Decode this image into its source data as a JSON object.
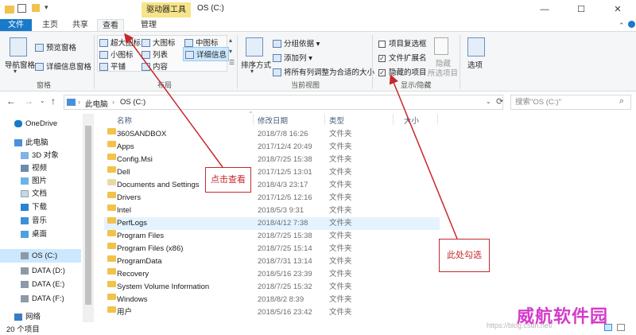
{
  "window": {
    "context_tab": "驱动器工具",
    "title": "OS (C:)",
    "minimize": "—",
    "maximize": "☐",
    "close": "✕"
  },
  "tabs": {
    "file": "文件",
    "home": "主页",
    "share": "共享",
    "view": "查看",
    "manage": "管理"
  },
  "ribbon": {
    "panes": {
      "nav_pane": "导航窗格",
      "preview_pane": "预览窗格",
      "details_pane": "详细信息窗格",
      "label": "窗格"
    },
    "layout": {
      "xl_icons": "超大图标",
      "large_icons": "大图标",
      "medium_icons": "中图标",
      "small_icons": "小图标",
      "list": "列表",
      "details": "详细信息",
      "tiles": "平铺",
      "content": "内容",
      "label": "布局"
    },
    "current_view": {
      "sort_by": "排序方式",
      "group_by": "分组依据",
      "add_columns": "添加列",
      "size_all_columns": "将所有列调整为合适的大小",
      "label": "当前视图"
    },
    "show_hide": {
      "item_checkboxes": "项目复选框",
      "file_extensions": "文件扩展名",
      "hidden_items": "隐藏的项目",
      "hide_selected_1": "隐藏",
      "hide_selected_2": "所选项目",
      "label": "显示/隐藏",
      "item_checkboxes_checked": false,
      "file_extensions_checked": true,
      "hidden_items_checked": true
    },
    "options": "选项"
  },
  "address": {
    "pc": "此电脑",
    "sep": "›",
    "drive": "OS (C:)",
    "search_placeholder": "搜索\"OS (C:)\""
  },
  "nav": {
    "onedrive": "OneDrive",
    "this_pc": "此电脑",
    "objects3d": "3D 对象",
    "videos": "视频",
    "pictures": "图片",
    "documents": "文档",
    "downloads": "下载",
    "music": "音乐",
    "desktop": "桌面",
    "os_c": "OS (C:)",
    "data_d": "DATA (D:)",
    "data_e": "DATA (E:)",
    "data_f": "DATA (F:)",
    "network": "网络"
  },
  "columns": {
    "name": "名称",
    "date": "修改日期",
    "type": "类型",
    "size": "大小"
  },
  "files": [
    {
      "name": "360SANDBOX",
      "date": "2018/7/8 16:26",
      "type": "文件夹"
    },
    {
      "name": "Apps",
      "date": "2017/12/4 20:49",
      "type": "文件夹"
    },
    {
      "name": "Config.Msi",
      "date": "2018/7/25 15:38",
      "type": "文件夹"
    },
    {
      "name": "Dell",
      "date": "2017/12/5 13:01",
      "type": "文件夹"
    },
    {
      "name": "Documents and Settings",
      "date": "2018/4/3 23:17",
      "type": "文件夹"
    },
    {
      "name": "Drivers",
      "date": "2017/12/5 12:16",
      "type": "文件夹"
    },
    {
      "name": "Intel",
      "date": "2018/5/3 9:31",
      "type": "文件夹"
    },
    {
      "name": "PerfLogs",
      "date": "2018/4/12 7:38",
      "type": "文件夹"
    },
    {
      "name": "Program Files",
      "date": "2018/7/25 15:38",
      "type": "文件夹"
    },
    {
      "name": "Program Files (x86)",
      "date": "2018/7/25 15:14",
      "type": "文件夹"
    },
    {
      "name": "ProgramData",
      "date": "2018/7/31 13:14",
      "type": "文件夹"
    },
    {
      "name": "Recovery",
      "date": "2018/5/16 23:39",
      "type": "文件夹"
    },
    {
      "name": "System Volume Information",
      "date": "2018/7/25 15:32",
      "type": "文件夹"
    },
    {
      "name": "Windows",
      "date": "2018/8/2 8:39",
      "type": "文件夹"
    },
    {
      "name": "用户",
      "date": "2018/5/16 23:42",
      "type": "文件夹"
    }
  ],
  "status": "20 个项目",
  "annotations": {
    "click_view": "点击查看",
    "check_here": "此处勾选"
  },
  "watermark": {
    "text": "威航软件园",
    "url": "https://blog.csdn.net/"
  },
  "colors": {
    "accent": "#1979ca",
    "annotation": "#c7282c",
    "watermark": "#d43acb"
  }
}
